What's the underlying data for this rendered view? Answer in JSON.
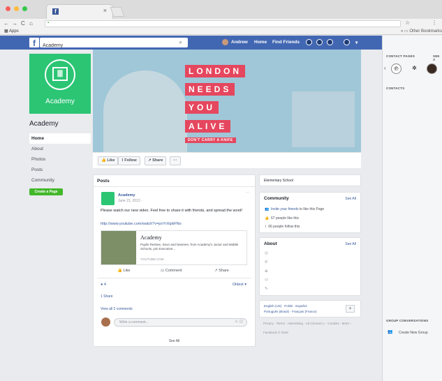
{
  "browser": {
    "tab_title": "",
    "fav_letter": "f",
    "apps_label": "Apps",
    "other_bookmarks": "Other Bookmarks",
    "url": ""
  },
  "fb": {
    "logo": "f",
    "search_value": "Academy",
    "user": "Andrew",
    "home": "Home",
    "find_friends": "Find Friends"
  },
  "page": {
    "logo_text": "Academy",
    "name": "Academy",
    "create_page": "Create a Page",
    "nav": [
      "Home",
      "About",
      "Photos",
      "Posts",
      "Community"
    ]
  },
  "cover": {
    "lines": [
      "LONDON",
      "NEEDS",
      "YOU",
      "ALIVE"
    ],
    "tagline": "DON'T CARRY A KNIFE"
  },
  "actions": {
    "like": "Like",
    "follow": "Follow",
    "share": "Share",
    "more": "···"
  },
  "posts": {
    "header": "Posts",
    "author": "Academy",
    "date": "June 21, 2013 ·",
    "text": "Please watch our new video. Feel free to share it with friends, and spread the word!",
    "link": "http://www.youtube.com/watch?v=pxYrXqikFNo",
    "preview": {
      "title": "Academy",
      "desc": "Pupils Reshee, Seun and Nasreen, from Academy's Junior and Middle Schools, join Executive...",
      "domain": "YOUTUBE.COM"
    },
    "like": "Like",
    "comment": "Comment",
    "share": "Share",
    "reactions": "4",
    "sort": "Oldest ▾",
    "shares": "1 Share",
    "view_comments": "View all 2 comments",
    "comment_placeholder": "Write a comment...",
    "see_all": "See All"
  },
  "side": {
    "category": "Elementary School",
    "community": "Community",
    "see_all": "See All",
    "invite_link": "Invite your friends",
    "invite_rest": " to like this Page",
    "likes": "67 people like this",
    "follows": "66 people follow this",
    "about": "About",
    "about_see_all": "See All",
    "lang1": "English (US) · Polski · Español",
    "lang2": "Português (Brasil) · Français (France)",
    "plus": "+",
    "footer": "Privacy · Terms · Advertising · Ad Choices ▷ · Cookies · More ›",
    "copyright": "Facebook © 2018"
  },
  "right": {
    "contact_pages": "CONTACT PAGES",
    "see_all": "SEE A",
    "contacts": "CONTACTS",
    "group_conv": "GROUP CONVERSATIONS",
    "create_group": "Create New Group"
  }
}
